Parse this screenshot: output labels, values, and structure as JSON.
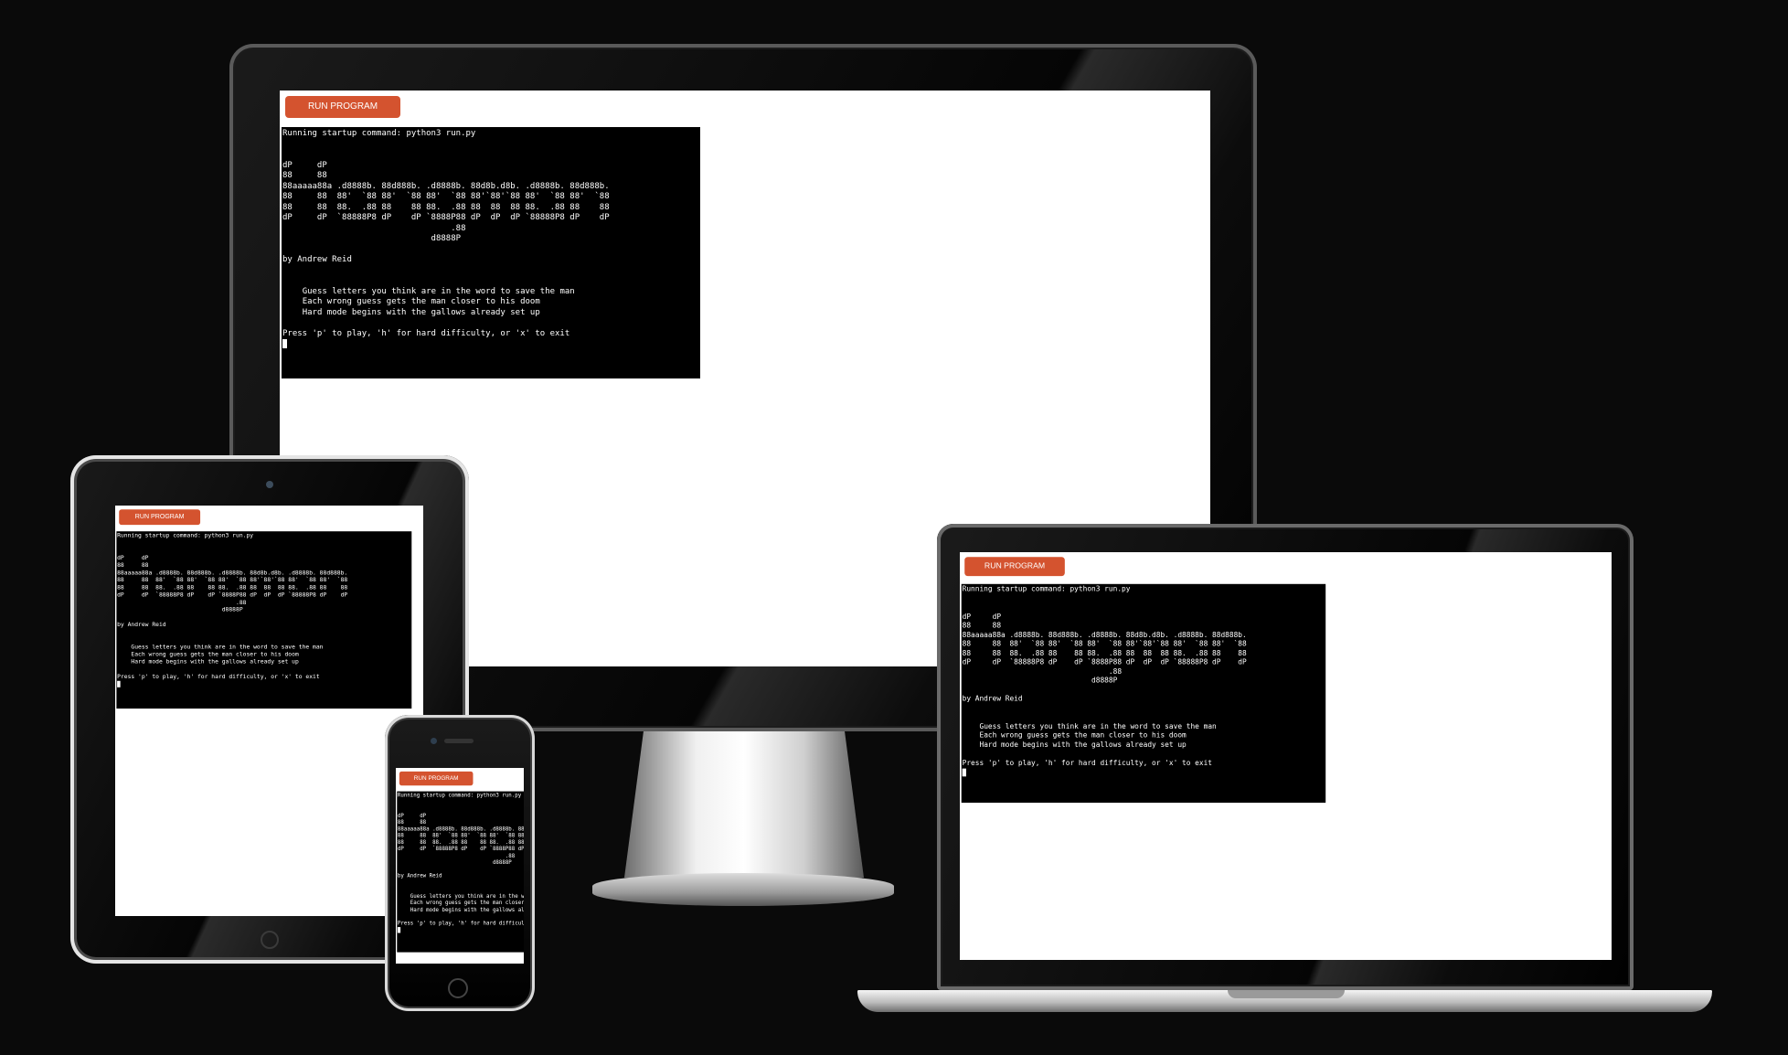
{
  "app": {
    "run_button_label": "RUN PROGRAM",
    "terminal": {
      "startup_line": "Running startup command: python3 run.py",
      "logo_lines": [
        "dP     dP",
        "88     88",
        "88aaaaa88a .d8888b. 88d888b. .d8888b. 88d8b.d8b. .d8888b. 88d888b.",
        "88     88  88'  `88 88'  `88 88'  `88 88'`88'`88 88'  `88 88'  `88",
        "88     88  88.  .88 88    88 88.  .88 88  88  88 88.  .88 88    88",
        "dP     dP  `88888P8 dP    dP `8888P88 dP  dP  dP `88888P8 dP    dP",
        "                                  .88",
        "                              d8888P"
      ],
      "author": "by Andrew Reid",
      "instructions": [
        "Guess letters you think are in the word to save the man",
        "Each wrong guess gets the man closer to his doom",
        "Hard mode begins with the gallows already set up"
      ],
      "prompt": "Press 'p' to play, 'h' for hard difficulty, or 'x' to exit"
    }
  },
  "devices": [
    "monitor",
    "tablet",
    "phone",
    "laptop"
  ],
  "colors": {
    "background": "#0a0a0a",
    "run_button": "#d4532f",
    "terminal_bg": "#000000",
    "terminal_text": "#ffffff",
    "screen_bg": "#ffffff"
  }
}
